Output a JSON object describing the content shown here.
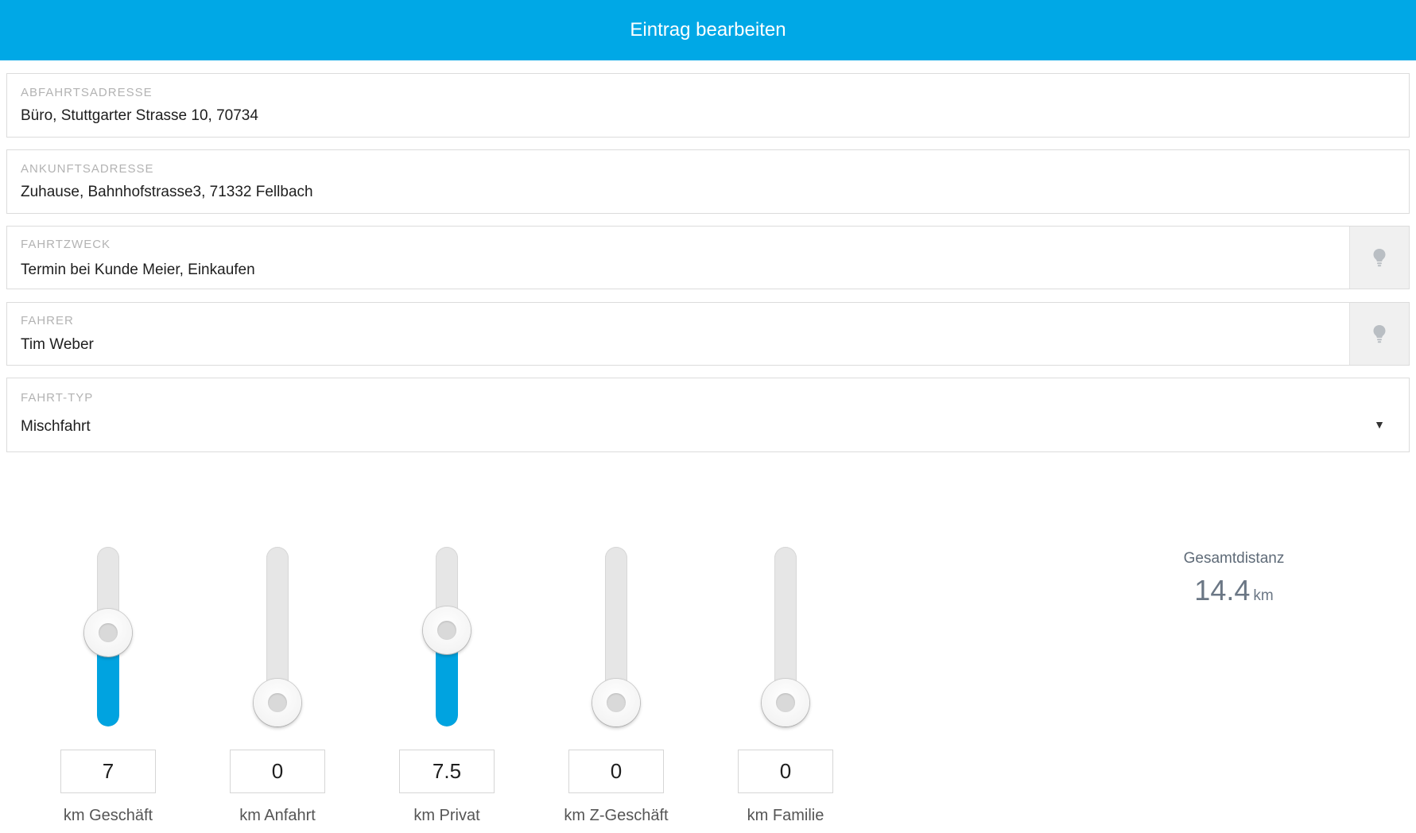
{
  "header": {
    "title": "Eintrag bearbeiten"
  },
  "fields": {
    "departure": {
      "label": "ABFAHRTSADRESSE",
      "value": "Büro, Stuttgarter Strasse 10, 70734"
    },
    "arrival": {
      "label": "ANKUNFTSADRESSE",
      "value": "Zuhause, Bahnhofstrasse3, 71332 Fellbach"
    },
    "purpose": {
      "label": "FAHRTZWECK",
      "value": "Termin bei Kunde Meier, Einkaufen",
      "hint_icon": "lightbulb-icon"
    },
    "driver": {
      "label": "FAHRER",
      "value": "Tim Weber",
      "hint_icon": "lightbulb-icon"
    },
    "trip_type": {
      "label": "FAHRT-TYP",
      "value": "Mischfahrt",
      "caret_icon": "caret-down-icon",
      "caret": "▼"
    }
  },
  "sliders": [
    {
      "label": "km Geschäft",
      "value": "7",
      "fill_percent": 48
    },
    {
      "label": "km Anfahrt",
      "value": "0",
      "fill_percent": 0
    },
    {
      "label": "km Privat",
      "value": "7.5",
      "fill_percent": 50
    },
    {
      "label": "km Z-Geschäft",
      "value": "0",
      "fill_percent": 0
    },
    {
      "label": "km Familie",
      "value": "0",
      "fill_percent": 0
    }
  ],
  "total": {
    "label": "Gesamtdistanz",
    "value": "14.4",
    "unit": "km"
  },
  "colors": {
    "header": "#00a8e6",
    "slider_fill": "#00a3e0"
  }
}
